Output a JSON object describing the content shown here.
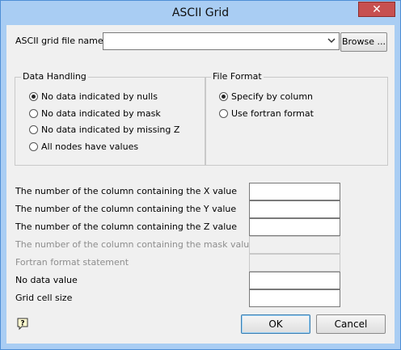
{
  "window": {
    "title": "ASCII Grid",
    "close_symbol": "✕"
  },
  "file": {
    "label": "ASCII grid file name",
    "value": "",
    "browse_label": "Browse ..."
  },
  "data_handling": {
    "title": "Data Handling",
    "options": [
      {
        "label": "No data indicated by nulls",
        "selected": true
      },
      {
        "label": "No data indicated by mask",
        "selected": false
      },
      {
        "label": "No data indicated by missing Z",
        "selected": false
      },
      {
        "label": "All nodes have values",
        "selected": false
      }
    ]
  },
  "file_format": {
    "title": "File Format",
    "options": [
      {
        "label": "Specify by column",
        "selected": true
      },
      {
        "label": "Use fortran format",
        "selected": false
      }
    ]
  },
  "fields": [
    {
      "label": "The number of the column containing the X value",
      "value": "",
      "enabled": true
    },
    {
      "label": "The number of the column containing the Y value",
      "value": "",
      "enabled": true
    },
    {
      "label": "The number of the column containing the Z value",
      "value": "",
      "enabled": true
    },
    {
      "label": "The number of the column containing the mask value",
      "value": "",
      "enabled": false
    },
    {
      "label": "Fortran format statement",
      "value": "",
      "enabled": false
    },
    {
      "label": "No data value",
      "value": "",
      "enabled": true
    },
    {
      "label": "Grid cell size",
      "value": "",
      "enabled": true
    }
  ],
  "buttons": {
    "ok": "OK",
    "cancel": "Cancel"
  },
  "icons": {
    "help": "help-icon",
    "dropdown": "chevron-down-icon",
    "close": "close-icon"
  }
}
